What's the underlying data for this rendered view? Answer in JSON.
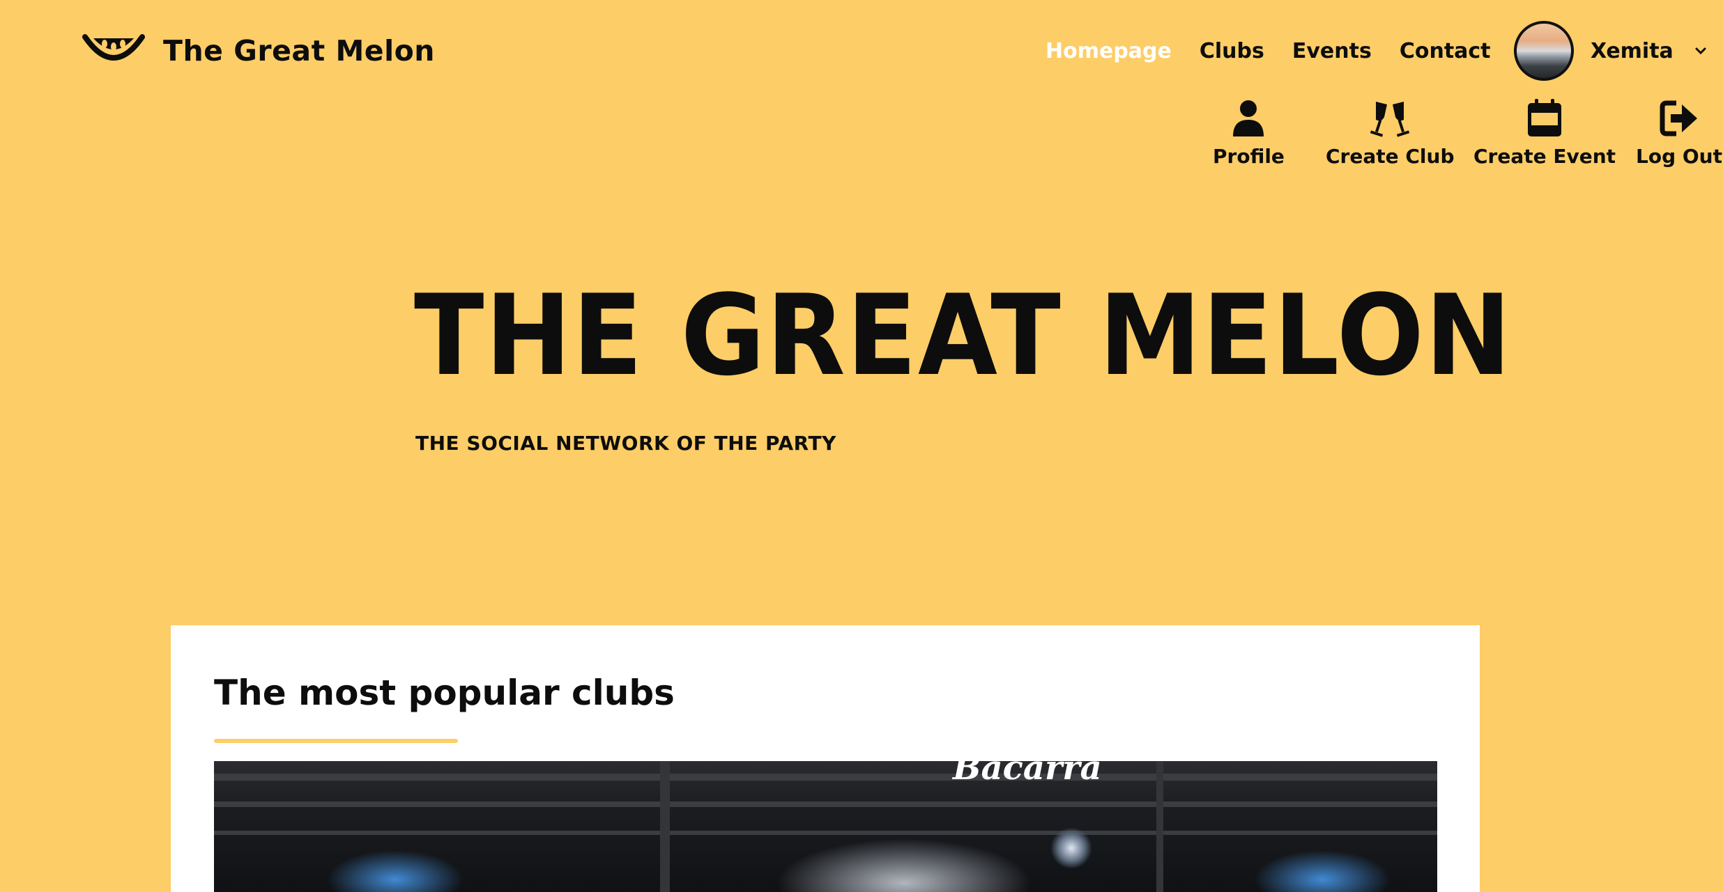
{
  "header": {
    "brand_name": "The Great Melon",
    "nav": [
      {
        "label": "Homepage",
        "active": true
      },
      {
        "label": "Clubs",
        "active": false
      },
      {
        "label": "Events",
        "active": false
      },
      {
        "label": "Contact",
        "active": false
      }
    ],
    "user": {
      "name": "Xemita",
      "avatar_icon": "avatar-photo",
      "caret_icon": "chevron-down-icon"
    }
  },
  "subnav": [
    {
      "label": "Profile",
      "icon": "user-icon"
    },
    {
      "label": "Create Club",
      "icon": "glasses-cheers-icon"
    },
    {
      "label": "Create Event",
      "icon": "calendar-icon"
    },
    {
      "label": "Log Out",
      "icon": "logout-icon"
    }
  ],
  "hero": {
    "title": "THE GREAT MELON",
    "subtitle": "THE SOCIAL NETWORK OF THE PARTY"
  },
  "popular": {
    "title": "The most popular clubs",
    "first_club_sign": "Bacarra"
  },
  "colors": {
    "background": "#fdcd67",
    "text": "#0d0d0d",
    "active_nav": "#ffffff",
    "card": "#ffffff"
  }
}
